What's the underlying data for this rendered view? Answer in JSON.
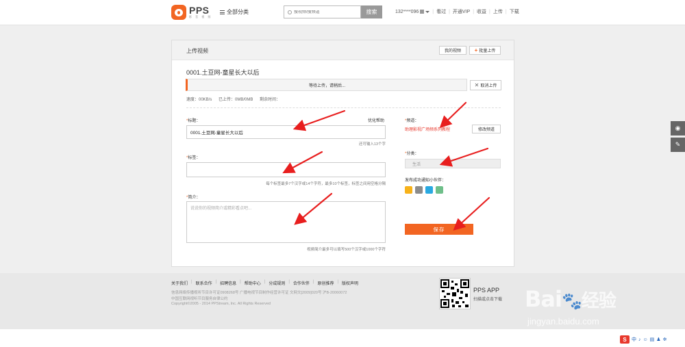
{
  "header": {
    "logo_name": "PPS",
    "logo_sub": "影 音 视 频",
    "all_categories": "全部分类",
    "search_placeholder": "搜视频/搜频道",
    "search_button": "搜索",
    "user": "132****096",
    "nav": [
      "看过",
      "开通VIP",
      "收益",
      "上传",
      "下载"
    ]
  },
  "panel": {
    "title": "上传视频",
    "my_videos": "我的视频",
    "batch_upload": "批量上传",
    "video_name": "0001.土豆网-童星长大以后",
    "progress_text": "等待上传，请稍后...",
    "cancel_upload": "取消上传",
    "stats": {
      "speed": "速度：00KB/s",
      "uploaded": "已上传：0MB/0MB",
      "remaining": "剩余时间："
    }
  },
  "form": {
    "title_label": "标题：",
    "title_help": "优化帮助",
    "title_value": "0001.土豆网-童星长大以后",
    "title_hint": "还可输入13个字",
    "tags_label": "标签：",
    "tags_value": "",
    "tags_hint": "每个标签最多7个汉字或14个字符，最多10个标签，标签之间用空格分隔",
    "intro_label": "简介：",
    "intro_placeholder": "说说你的视频简介或精彩看点吧...",
    "intro_hint": "视频简介最多可以填写500个汉字或1000个字符",
    "channel_label": "频道：",
    "channel_value": "助理影视广场频系列教程",
    "change_channel": "修改频道",
    "category_label": "分类：",
    "category_value": "生活",
    "share_label": "发布成功通知小伙伴：",
    "share_icons": [
      "weibo-icon",
      "renren-icon",
      "qzone-icon",
      "tqq-icon"
    ],
    "save_button": "保存"
  },
  "footer": {
    "links": [
      "关于我们",
      "联系合作",
      "招聘信息",
      "帮助中心",
      "分成规则",
      "合作伙伴",
      "原创推荐",
      "版权声明"
    ],
    "line1": "信息网络传播视听节目许可证0908268号    广播电视节目制作经营许可证    文网文[2009]020号    沪B-20060072",
    "line2": "中国互联网视听节目服务自律公约",
    "line3": "Copyright©2005 - 2014 PPStream, Inc. All Rights Reserved",
    "app_title": "PPS APP",
    "app_sub": "扫描或点击下载"
  },
  "watermark": {
    "main": "Bai",
    "cn": "经验",
    "sub": "jingyan.baidu.com"
  },
  "tray": {
    "logo": "S",
    "items": [
      "中",
      "♪",
      "☺",
      "▤",
      "♟",
      "✲"
    ]
  },
  "colors": {
    "accent": "#f26522",
    "arrow": "#e81e1e",
    "link_red": "#e8382c"
  }
}
